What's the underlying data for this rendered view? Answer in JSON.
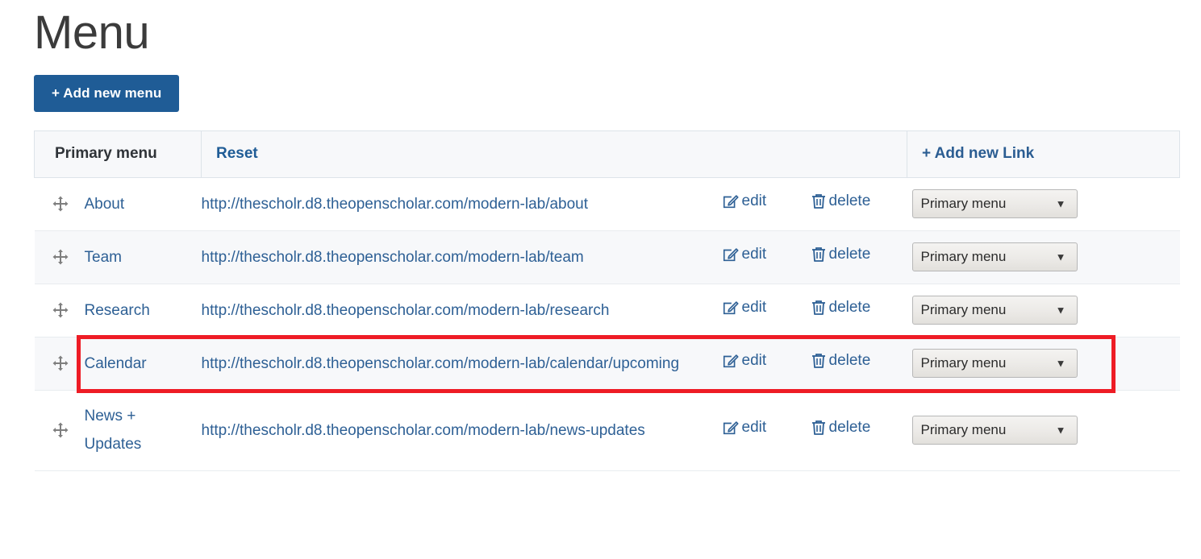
{
  "page": {
    "title": "Menu"
  },
  "toolbar": {
    "add_menu_label": "+ Add new menu"
  },
  "table": {
    "headers": {
      "name": "Primary menu",
      "reset": "Reset",
      "add_link": "+ Add new Link"
    },
    "actions": {
      "edit": "edit",
      "delete": "delete"
    },
    "select_value": "Primary menu",
    "rows": [
      {
        "title": "About",
        "url": "http://thescholr.d8.theopenscholar.com/modern-lab/about",
        "menu": "Primary menu",
        "striped": false,
        "highlighted": false
      },
      {
        "title": "Team",
        "url": "http://thescholr.d8.theopenscholar.com/modern-lab/team",
        "menu": "Primary menu",
        "striped": true,
        "highlighted": false
      },
      {
        "title": "Research",
        "url": "http://thescholr.d8.theopenscholar.com/modern-lab/research",
        "menu": "Primary menu",
        "striped": false,
        "highlighted": false
      },
      {
        "title": "Calendar",
        "url": "http://thescholr.d8.theopenscholar.com/modern-lab/calendar/upcoming",
        "menu": "Primary menu",
        "striped": true,
        "highlighted": true
      },
      {
        "title": "News + Updates",
        "url": "http://thescholr.d8.theopenscholar.com/modern-lab/news-updates",
        "menu": "Primary menu",
        "striped": false,
        "highlighted": false
      }
    ]
  },
  "icons": {
    "drag": "drag-move-icon",
    "edit": "edit-pencil-icon",
    "delete": "trash-icon",
    "select_arrow": "▼"
  },
  "colors": {
    "accent_blue": "#1f5c96",
    "link_blue": "#2e6095",
    "highlight_red": "#ee1c25",
    "header_bg": "#f7f8fa",
    "stripe_bg": "#f7f8fa"
  }
}
